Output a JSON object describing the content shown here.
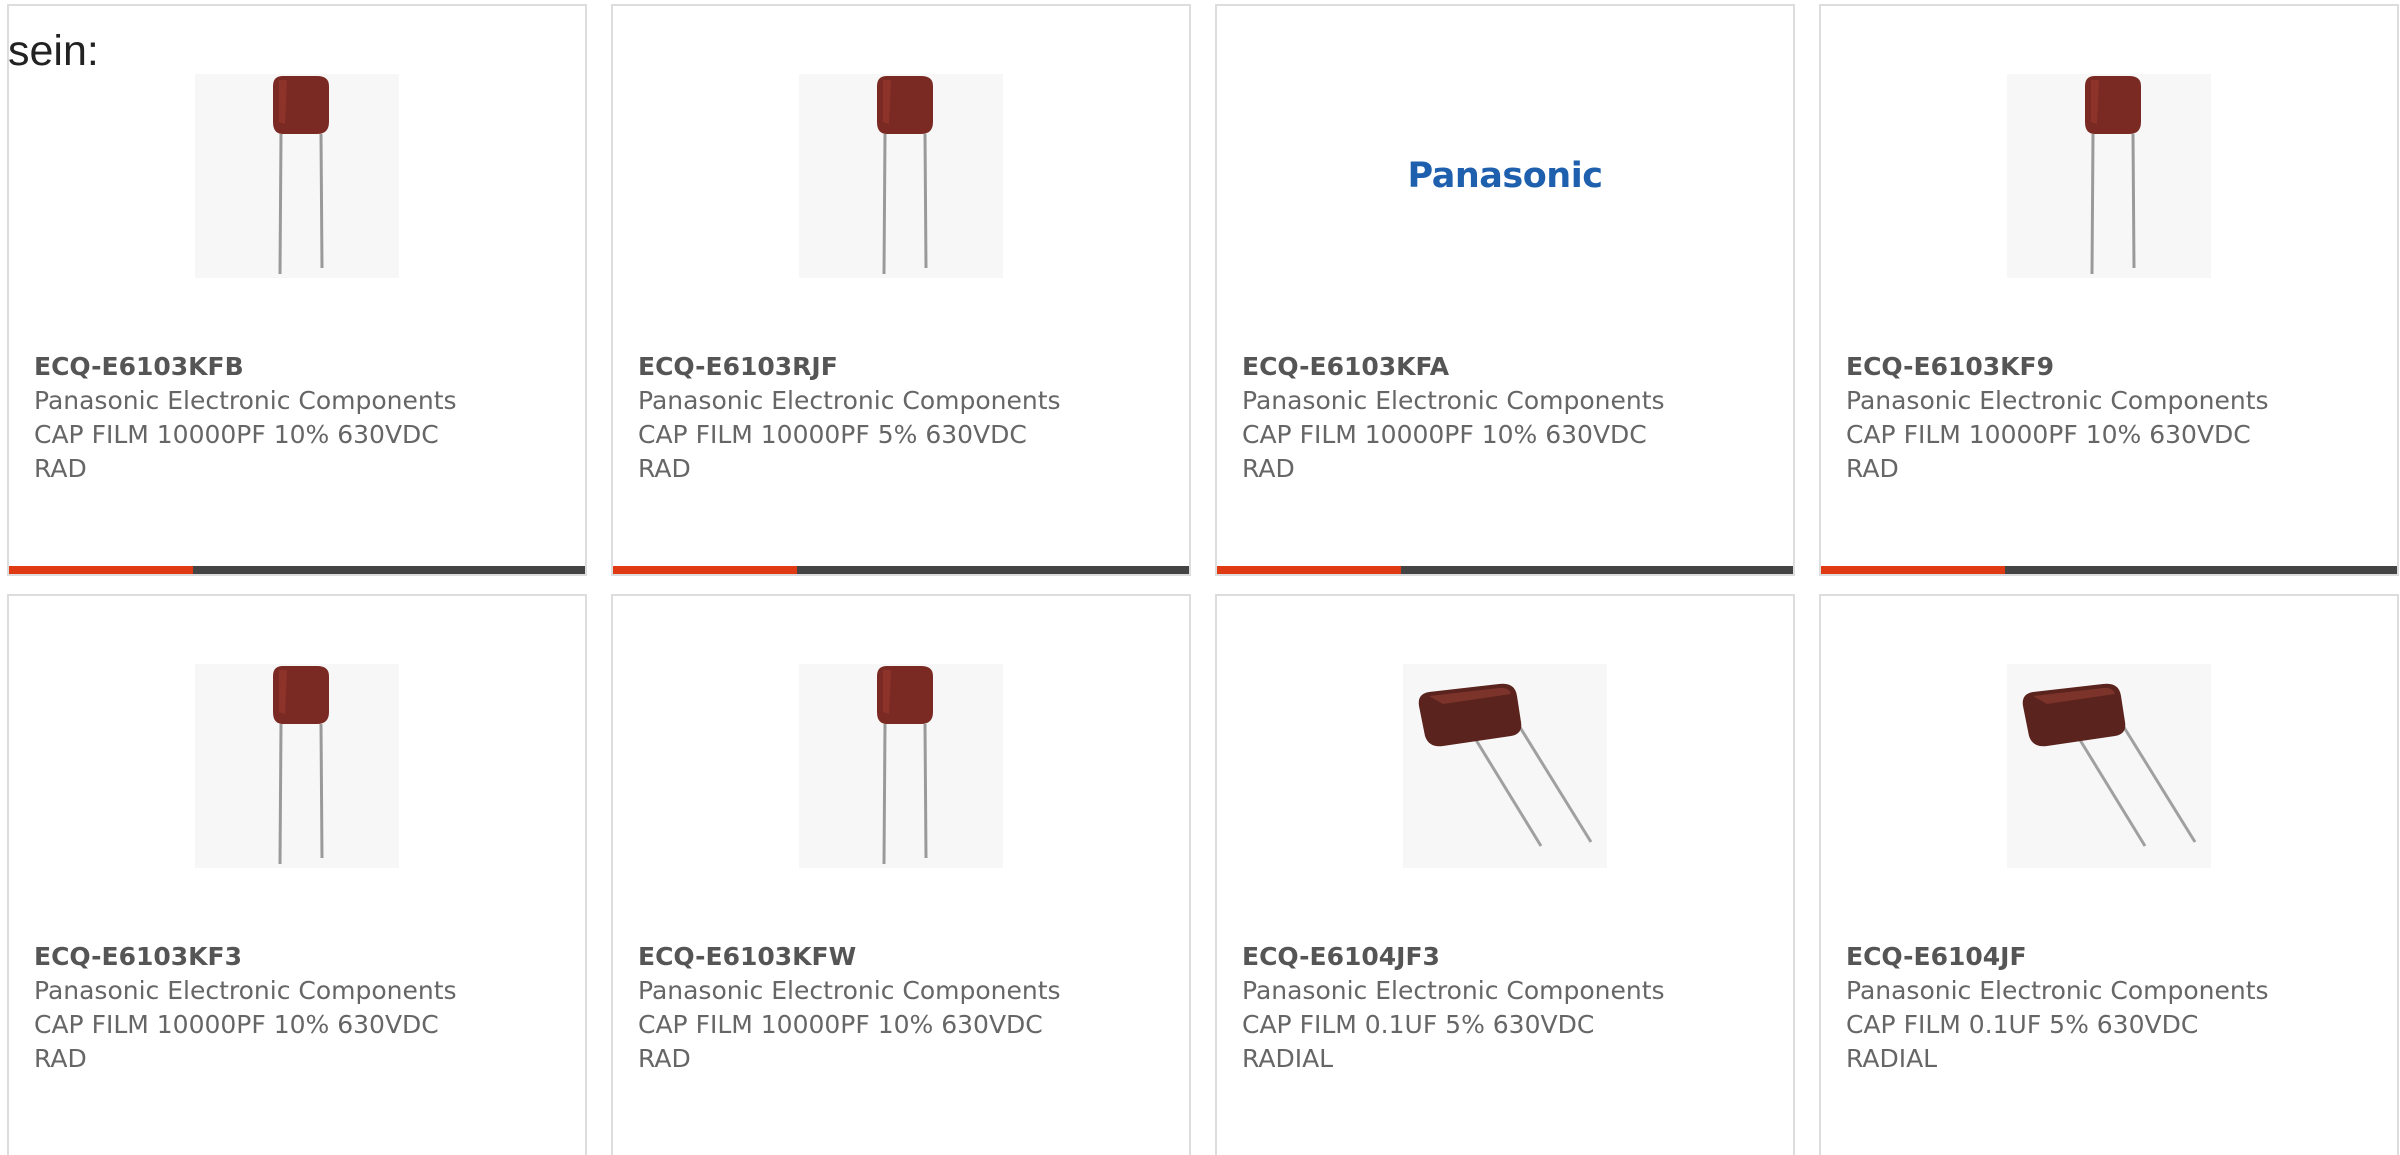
{
  "intro_text": "sein:",
  "colors": {
    "accent": "#e03a14",
    "bar": "#444444",
    "border": "#dddddd",
    "brand_blue": "#1e5fae",
    "capacitor_body": "#7a2a22"
  },
  "products": [
    {
      "part_number": "ECQ-E6103KFB",
      "manufacturer": "Panasonic Electronic Components",
      "description": "CAP FILM 10000PF 10% 630VDC RAD",
      "image": "upright-film-capacitor"
    },
    {
      "part_number": "ECQ-E6103RJF",
      "manufacturer": "Panasonic Electronic Components",
      "description": "CAP FILM 10000PF 5% 630VDC RAD",
      "image": "upright-film-capacitor"
    },
    {
      "part_number": "ECQ-E6103KFA",
      "manufacturer": "Panasonic Electronic Components",
      "description": "CAP FILM 10000PF 10% 630VDC RAD",
      "image": "panasonic-logo",
      "logo_text": "Panasonic"
    },
    {
      "part_number": "ECQ-E6103KF9",
      "manufacturer": "Panasonic Electronic Components",
      "description": "CAP FILM 10000PF 10% 630VDC RAD",
      "image": "upright-film-capacitor"
    },
    {
      "part_number": "ECQ-E6103KF3",
      "manufacturer": "Panasonic Electronic Components",
      "description": "CAP FILM 10000PF 10% 630VDC RAD",
      "image": "upright-film-capacitor"
    },
    {
      "part_number": "ECQ-E6103KFW",
      "manufacturer": "Panasonic Electronic Components",
      "description": "CAP FILM 10000PF 10% 630VDC RAD",
      "image": "upright-film-capacitor"
    },
    {
      "part_number": "ECQ-E6104JF3",
      "manufacturer": "Panasonic Electronic Components",
      "description": "CAP FILM 0.1UF 5% 630VDC RADIAL",
      "image": "tilted-film-capacitor"
    },
    {
      "part_number": "ECQ-E6104JF",
      "manufacturer": "Panasonic Electronic Components",
      "description": "CAP FILM 0.1UF 5% 630VDC RADIAL",
      "image": "tilted-film-capacitor"
    }
  ]
}
